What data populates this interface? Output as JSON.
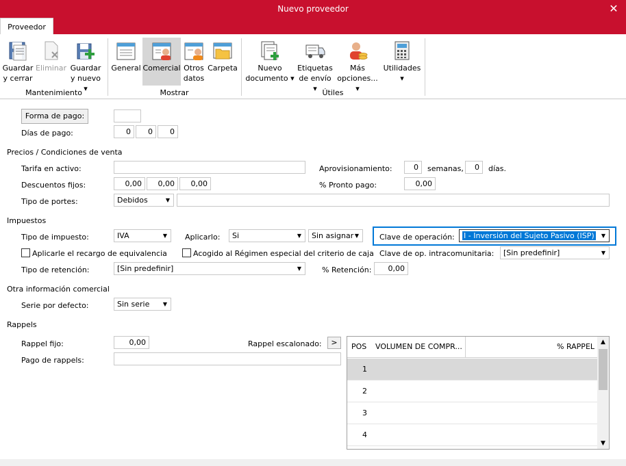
{
  "window": {
    "title": "Nuevo proveedor",
    "close_glyph": "✕"
  },
  "tabs": [
    {
      "label": "Proveedor"
    }
  ],
  "ribbon": {
    "buttons": [
      {
        "line1": "Guardar",
        "line2": "y cerrar",
        "icon": "save-close-icon"
      },
      {
        "line1": "Eliminar",
        "line2": "",
        "icon": "delete-icon"
      },
      {
        "line1": "Guardar",
        "line2": "y nuevo ▾",
        "icon": "save-new-icon"
      },
      {
        "line1": "General",
        "line2": "",
        "icon": "form-general-icon"
      },
      {
        "line1": "Comercial",
        "line2": "",
        "icon": "form-commercial-icon"
      },
      {
        "line1": "Otros",
        "line2": "datos",
        "icon": "form-other-icon"
      },
      {
        "line1": "Carpeta",
        "line2": "",
        "icon": "folder-icon"
      },
      {
        "line1": "Nuevo",
        "line2": "documento ▾",
        "icon": "new-document-icon"
      },
      {
        "line1": "Etiquetas",
        "line2": "de envío ▾",
        "icon": "shipping-truck-icon"
      },
      {
        "line1": "Más",
        "line2": "opciones... ▾",
        "icon": "more-options-icon"
      },
      {
        "line1": "Utilidades",
        "line2": "▾",
        "icon": "calculator-icon"
      }
    ],
    "groups": {
      "mantenimiento": "Mantenimiento",
      "mostrar": "Mostrar",
      "utiles": "Útiles"
    }
  },
  "form": {
    "forma_pago_button": "Forma de pago:",
    "forma_pago_value": "",
    "dias_pago_label": "Días de pago:",
    "dias_pago": [
      "0",
      "0",
      "0"
    ],
    "precios_section": "Precios / Condiciones de venta",
    "tarifa_label": "Tarifa en activo:",
    "tarifa_value": "",
    "descuentos_label": "Descuentos fijos:",
    "descuentos": [
      "0,00",
      "0,00",
      "0,00"
    ],
    "portes_label": "Tipo de portes:",
    "portes_value": "Debidos",
    "portes_extra": "",
    "aprovisionamiento_label": "Aprovisionamiento:",
    "aprov_semanas": "0",
    "semanas_label": "semanas,",
    "aprov_dias": "0",
    "dias_label": "días.",
    "pronto_pago_label": "% Pronto pago:",
    "pronto_pago_value": "0,00",
    "impuestos_section": "Impuestos",
    "tipo_impuesto_label": "Tipo de impuesto:",
    "tipo_impuesto_value": "IVA",
    "aplicarlo_label": "Aplicarlo:",
    "aplicarlo_value": "Si",
    "asignar_value": "Sin asignar",
    "clave_operacion_label": "Clave de operación:",
    "clave_operacion_value": "I - Inversión del Sujeto Pasivo (ISP)",
    "recargo_label": "Aplicarle el recargo de equivalencia",
    "criterio_caja_label": "Acogido al Régimen especial del criterio de caja",
    "clave_intra_label": "Clave de op. intracomunitaria:",
    "clave_intra_value": "[Sin predefinir]",
    "tipo_retencion_label": "Tipo de retención:",
    "tipo_retencion_value": "[Sin predefinir]",
    "retencion_label": "% Retención:",
    "retencion_value": "0,00",
    "otra_info_section": "Otra información comercial",
    "serie_label": "Serie por defecto:",
    "serie_value": "Sin serie",
    "rappels_section": "Rappels",
    "rappel_fijo_label": "Rappel fijo:",
    "rappel_fijo_value": "0,00",
    "rappel_escalonado_label": "Rappel escalonado:",
    "rappel_escalonado_button": ">",
    "pago_rappels_label": "Pago de rappels:",
    "pago_rappels_value": ""
  },
  "rappel_grid": {
    "columns": [
      "POS",
      "VOLUMEN DE COMPR...",
      "% RAPPEL"
    ],
    "rows": [
      [
        "1",
        "",
        ""
      ],
      [
        "2",
        "",
        ""
      ],
      [
        "3",
        "",
        ""
      ],
      [
        "4",
        "",
        ""
      ]
    ]
  },
  "colors": {
    "accent": "#c8102e",
    "focus_border": "#0078d7",
    "selection": "#0078d7"
  }
}
